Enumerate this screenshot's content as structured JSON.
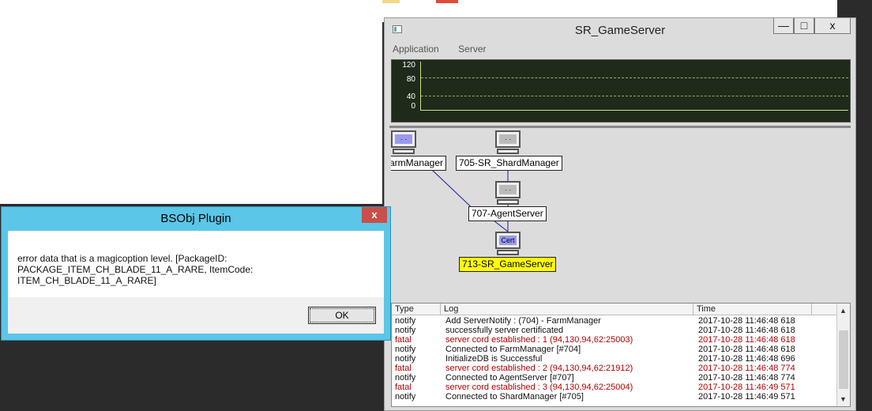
{
  "game_server": {
    "title": "SR_GameServer",
    "buttons": {
      "minimize": "—",
      "maximize": "□",
      "close": "x"
    },
    "menu": [
      "Application",
      "Server"
    ],
    "graph": {
      "y_ticks": [
        "120",
        "80",
        "40",
        "0"
      ]
    },
    "nodes": [
      {
        "label": "armManager",
        "icon": "pc-active-icon"
      },
      {
        "label": "705-SR_ShardManager",
        "icon": "pc-icon"
      },
      {
        "label": "707-AgentServer",
        "icon": "pc-icon"
      },
      {
        "label": "713-SR_GameServer",
        "icon": "pc-cert-icon",
        "icon_text": "Cert",
        "highlight": "#ffff00"
      }
    ],
    "log": {
      "columns": [
        "Type",
        "Log",
        "Time"
      ],
      "rows": [
        {
          "type": "notify",
          "log": "Add ServerNotify : (704) - FarmManager",
          "time": "2017-10-28 11:46:48 618"
        },
        {
          "type": "notify",
          "log": "successfully server certificated",
          "time": "2017-10-28 11:46:48 618"
        },
        {
          "type": "fatal",
          "log": "server cord established : 1 (94,130,94,62:25003)",
          "time": "2017-10-28 11:46:48 618"
        },
        {
          "type": "notify",
          "log": "Connected to FarmManager [#704]",
          "time": "2017-10-28 11:46:48 618"
        },
        {
          "type": "notify",
          "log": "InitializeDB is Successful",
          "time": "2017-10-28 11:46:48 696"
        },
        {
          "type": "fatal",
          "log": "server cord established : 2 (94,130,94,62:21912)",
          "time": "2017-10-28 11:46:48 774"
        },
        {
          "type": "notify",
          "log": "Connected to AgentServer [#707]",
          "time": "2017-10-28 11:46:48 774"
        },
        {
          "type": "fatal",
          "log": "server cord established : 3 (94,130,94,62:25004)",
          "time": "2017-10-28 11:46:49 571"
        },
        {
          "type": "notify",
          "log": "Connected to ShardManager [#705]",
          "time": "2017-10-28 11:46:49 571"
        }
      ]
    }
  },
  "dialog": {
    "title": "BSObj Plugin",
    "close": "x",
    "message_line1": "error data that is a magicoption level. [PackageID:",
    "message_line2": "PACKAGE_ITEM_CH_BLADE_11_A_RARE, ItemCode: ITEM_CH_BLADE_11_A_RARE]",
    "ok_label": "OK"
  },
  "colors": {
    "fatal": "#b40000",
    "dialog_title": "#5bc6e8",
    "graph_bg": "#1f2a1a",
    "highlight": "#ffff00"
  }
}
